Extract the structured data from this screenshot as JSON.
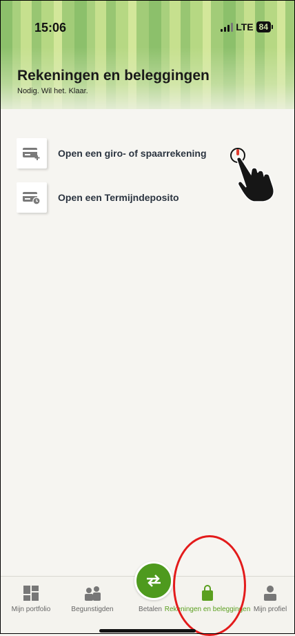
{
  "status_bar": {
    "time": "15:06",
    "network": "LTE",
    "battery": "84"
  },
  "header": {
    "title": "Rekeningen en beleggingen",
    "subtitle": "Nodig. Wil het. Klaar."
  },
  "options": [
    {
      "label": "Open een giro- of spaarrekening",
      "icon": "card-plus-icon"
    },
    {
      "label": "Open een Termijndeposito",
      "icon": "card-clock-icon"
    }
  ],
  "tabbar": {
    "items": [
      {
        "label": "Mijn portfolio",
        "icon": "portfolio-grid-icon"
      },
      {
        "label": "Begunstigden",
        "icon": "people-icon"
      },
      {
        "label": "Betalen",
        "icon": "transfer-arrows-icon"
      },
      {
        "label": "Rekeningen en beleggingen",
        "icon": "bag-icon",
        "active": true
      },
      {
        "label": "Mijn profiel",
        "icon": "person-icon"
      }
    ]
  },
  "colors": {
    "accent": "#4e9a1e",
    "active_tab": "#5a9f1f",
    "annotation": "#e31b1b"
  }
}
